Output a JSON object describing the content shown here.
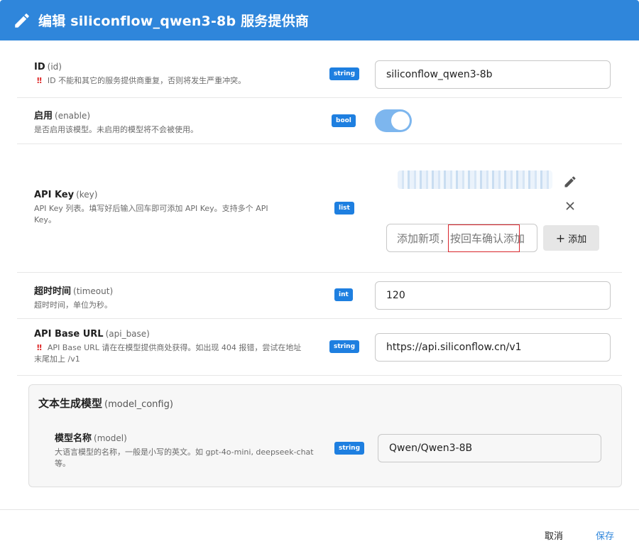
{
  "dialog": {
    "title": "编辑 siliconflow_qwen3-8b 服务提供商"
  },
  "fields": {
    "id": {
      "label": "ID",
      "key": "(id)",
      "warn": "‼",
      "desc": "ID 不能和其它的服务提供商重复，否则将发生严重冲突。",
      "type": "string",
      "value": "siliconflow_qwen3-8b"
    },
    "enable": {
      "label": "启用",
      "key": "(enable)",
      "desc": "是否启用该模型。未启用的模型将不会被使用。",
      "type": "bool",
      "value": true
    },
    "api_key": {
      "label": "API Key",
      "key": "(key)",
      "desc": "API Key 列表。填写好后输入回车即可添加 API Key。支持多个 API Key。",
      "type": "list",
      "placeholder": "添加新项，按回车确认添加",
      "add_label": "添加"
    },
    "timeout": {
      "label": "超时时间",
      "key": "(timeout)",
      "desc": "超时时间，单位为秒。",
      "type": "int",
      "value": "120"
    },
    "api_base": {
      "label": "API Base URL",
      "key": "(api_base)",
      "warn": "‼",
      "desc": "API Base URL 请在在模型提供商处获得。如出现 404 报错，尝试在地址末尾加上 /v1",
      "type": "string",
      "value": "https://api.siliconflow.cn/v1"
    }
  },
  "model_config": {
    "title": "文本生成模型",
    "key": "(model_config)",
    "model": {
      "label": "模型名称",
      "key": "(model)",
      "desc": "大语言模型的名称，一般是小写的英文。如 gpt-4o-mini, deepseek-chat 等。",
      "type": "string",
      "value": "Qwen/Qwen3-8B"
    }
  },
  "footer": {
    "cancel_label": "取消",
    "save_label": "保存"
  },
  "colors": {
    "header": "#2f86db",
    "badge": "#1e7fe0",
    "toggle_on": "#7db6ee",
    "save": "#2f86db",
    "highlight_box": "#d9262c"
  },
  "icons": {
    "header": "pencil-icon",
    "edit": "pencil-icon",
    "remove": "close-icon",
    "add": "plus-icon"
  }
}
